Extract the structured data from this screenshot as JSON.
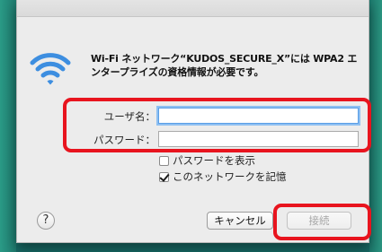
{
  "dialog": {
    "message": "Wi-Fi ネットワーク“KUDOS_SECURE_X”には WPA2 エンタープライズの資格情報が必要です。",
    "icon": "wifi-icon"
  },
  "form": {
    "username_label": "ユーザ名：",
    "username_value": "",
    "password_label": "パスワード：",
    "password_value": ""
  },
  "options": {
    "show_password_label": "パスワードを表示",
    "show_password_checked": false,
    "remember_network_label": "このネットワークを記憶",
    "remember_network_checked": true
  },
  "buttons": {
    "help_label": "?",
    "cancel_label": "キャンセル",
    "connect_label": "接続"
  },
  "colors": {
    "highlight": "#e8141e",
    "wifi_blue": "#3d8ee0",
    "focus_ring": "#8ec0f2"
  }
}
